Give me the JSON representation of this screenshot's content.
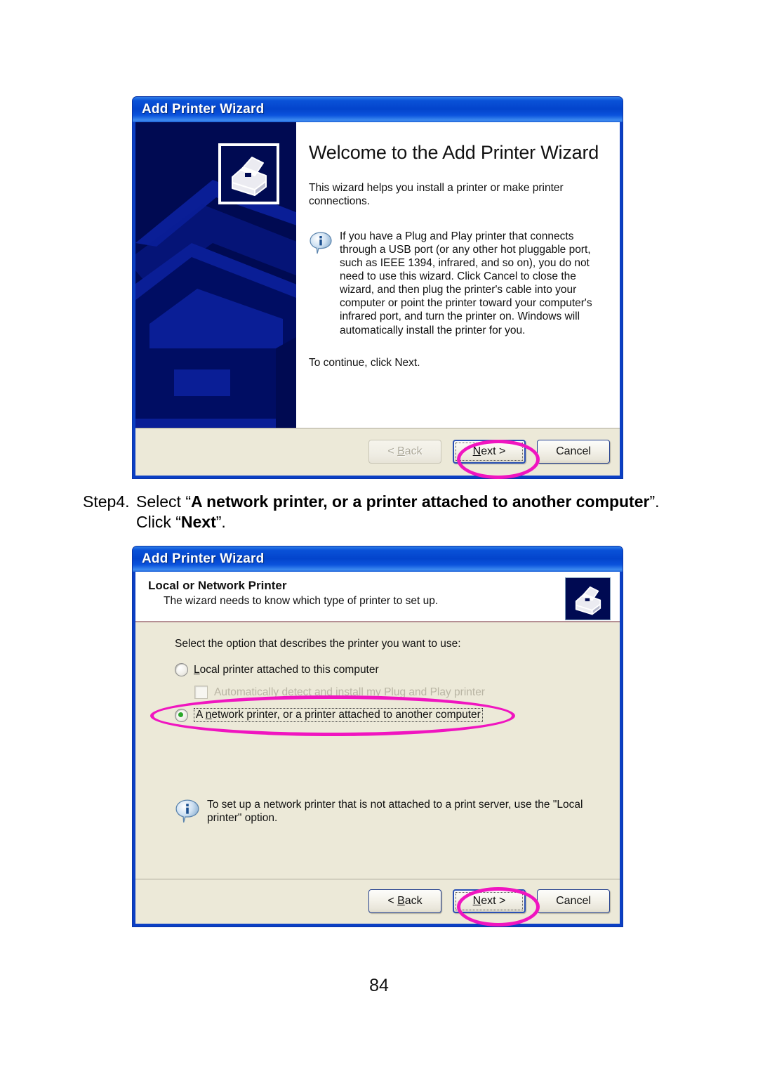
{
  "page": {
    "number": "84"
  },
  "step": {
    "label": "Step4.",
    "text_pre": "Select “",
    "bold1": "A network printer, or a printer attached to another computer",
    "text_mid": "”. Click “",
    "bold2": "Next",
    "text_post": "”."
  },
  "dialog1": {
    "title": "Add Printer Wizard",
    "heading": "Welcome to the Add Printer Wizard",
    "intro": "This wizard helps you install a printer or make printer connections.",
    "note": "If you have a Plug and Play printer that connects through a USB port (or any other hot pluggable port, such as IEEE 1394, infrared, and so on), you do not need to use this wizard. Click Cancel to close the wizard, and then plug the printer's cable into your computer or point the printer toward your computer's infrared port, and turn the printer on. Windows will automatically install the printer for you.",
    "continue": "To continue, click Next.",
    "buttons": {
      "back": "< Back",
      "back_accel": "B",
      "next": "Next >",
      "next_accel": "N",
      "cancel": "Cancel",
      "back_disabled": true,
      "next_focused": true
    },
    "icons": {
      "banner": "printer-icon",
      "note": "info-icon"
    }
  },
  "dialog2": {
    "title": "Add Printer Wizard",
    "header_title": "Local or Network Printer",
    "header_sub": "The wizard needs to know which type of printer to set up.",
    "intro": "Select the option that describes the printer you want to use:",
    "options": [
      {
        "label": "Local printer attached to this computer",
        "accel": "L",
        "selected": false,
        "focused": false
      },
      {
        "label": "A network printer, or a printer attached to another computer",
        "accel": "n",
        "selected": true,
        "focused": true
      }
    ],
    "checkbox": {
      "label": "Automatically detect and install my Plug and Play printer",
      "checked": false,
      "disabled": true
    },
    "note": "To set up a network printer that is not attached to a print server, use the \"Local printer\" option.",
    "buttons": {
      "back": "< Back",
      "back_accel": "B",
      "next": "Next >",
      "next_accel": "N",
      "cancel": "Cancel",
      "back_disabled": false,
      "next_focused": true
    },
    "icons": {
      "header": "printer-icon",
      "note": "info-icon"
    }
  },
  "annotations": {
    "color": "#f015c0",
    "marks": [
      "ellipse-around-next-button-dialog1",
      "ellipse-around-network-printer-option",
      "ellipse-around-next-button-dialog2"
    ]
  }
}
